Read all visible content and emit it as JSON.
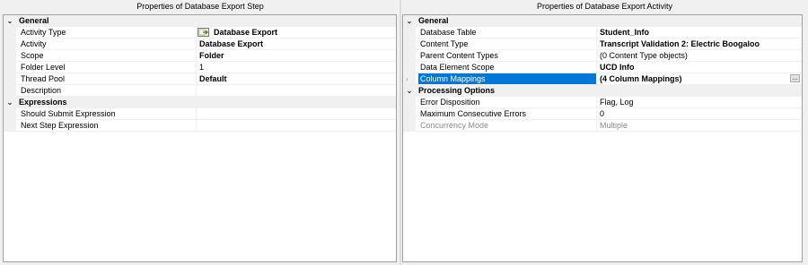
{
  "left": {
    "title": "Properties of Database Export Step",
    "categories": {
      "general": "General",
      "expressions": "Expressions"
    },
    "props": {
      "activity_type": {
        "name": "Activity Type",
        "value": "Database Export",
        "icon": "database-export-icon"
      },
      "activity": {
        "name": "Activity",
        "value": "Database Export"
      },
      "scope": {
        "name": "Scope",
        "value": "Folder"
      },
      "folder_level": {
        "name": "Folder Level",
        "value": "1"
      },
      "thread_pool": {
        "name": "Thread Pool",
        "value": "Default"
      },
      "description": {
        "name": "Description",
        "value": ""
      },
      "should_submit": {
        "name": "Should Submit Expression",
        "value": ""
      },
      "next_step": {
        "name": "Next Step Expression",
        "value": ""
      }
    }
  },
  "right": {
    "title": "Properties of Database Export Activity",
    "categories": {
      "general": "General",
      "processing": "Processing Options"
    },
    "props": {
      "database_table": {
        "name": "Database Table",
        "value": "Student_Info"
      },
      "content_type": {
        "name": "Content Type",
        "value": "Transcript Validation 2: Electric Boogaloo"
      },
      "parent_content_types": {
        "name": "Parent Content Types",
        "value": "(0 Content Type objects)"
      },
      "data_element_scope": {
        "name": "Data Element Scope",
        "value": "UCD Info"
      },
      "column_mappings": {
        "name": "Column Mappings",
        "value": "(4 Column Mappings)",
        "button": "..."
      },
      "error_disposition": {
        "name": "Error Disposition",
        "value": "Flag, Log"
      },
      "max_consecutive_errors": {
        "name": "Maximum Consecutive Errors",
        "value": "0"
      },
      "concurrency_mode": {
        "name": "Concurrency Mode",
        "value": "Multiple"
      }
    }
  },
  "colors": {
    "selection": "#0078d7",
    "category_bg": "#f0f0f0",
    "disabled_text": "#8d8d8d"
  }
}
